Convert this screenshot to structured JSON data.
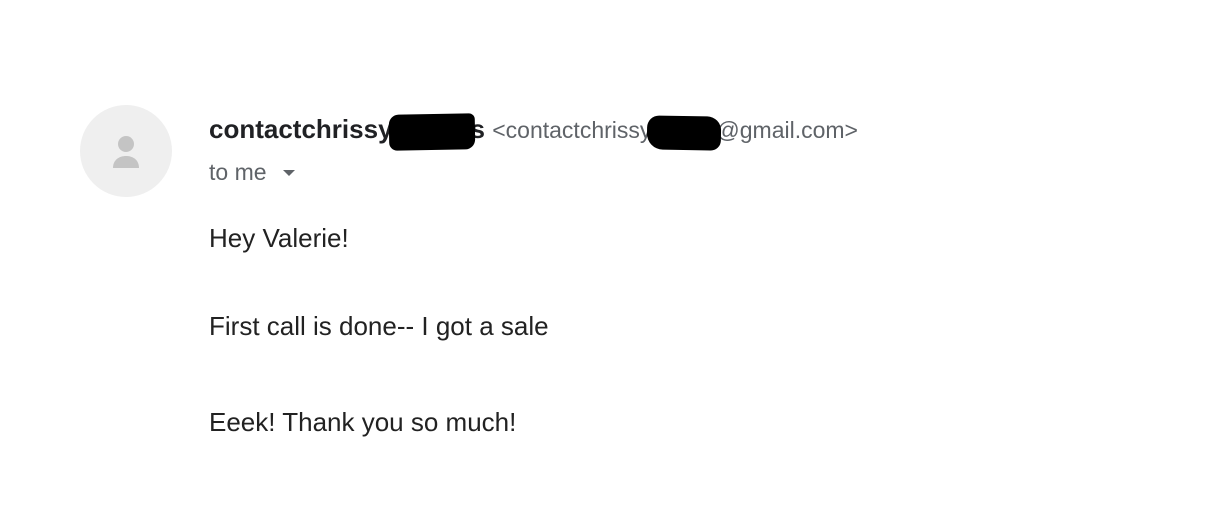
{
  "email": {
    "sender": {
      "name_prefix": "contactchrissy",
      "name_suffix": "s",
      "email_open": "<",
      "email_prefix": "contactchrissy",
      "email_suffix": "@gmail.com>"
    },
    "recipient_label": "to me",
    "body_lines": [
      "Hey Valerie!",
      "First call is done-- I got a sale",
      "Eeek! Thank you so much!"
    ]
  },
  "icons": {
    "avatar": "person-icon",
    "details": "chevron-down-icon"
  },
  "colors": {
    "avatar_background": "#efefef",
    "avatar_icon": "#c4c4c4",
    "sender_name": "#202124",
    "secondary_text": "#5f6368",
    "body_text": "#222222",
    "redaction": "#000000"
  }
}
